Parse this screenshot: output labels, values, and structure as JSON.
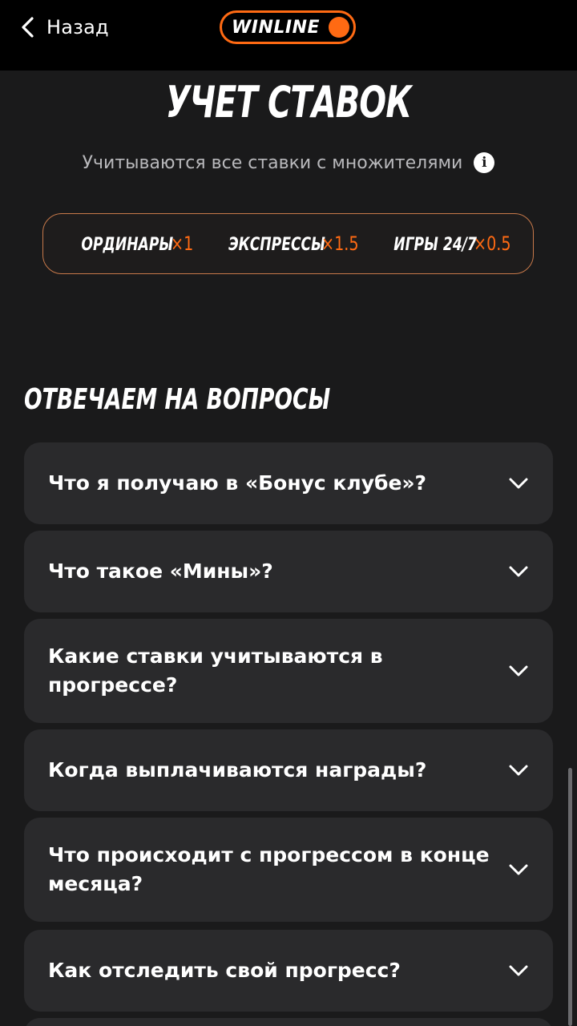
{
  "header": {
    "back_label": "Назад",
    "logo_text": "WINLINE",
    "brand_color": "#ff6a13"
  },
  "bets": {
    "title": "УЧЕТ СТАВОК",
    "subtitle": "Учитываются все ставки с множителями",
    "info_icon": "info-icon",
    "multipliers": [
      {
        "label": "ОРДИНАРЫ",
        "value": "×1"
      },
      {
        "label": "ЭКСПРЕССЫ",
        "value": "×1.5"
      },
      {
        "label": "ИГРЫ 24/7",
        "value": "×0.5"
      }
    ]
  },
  "faq": {
    "title": "ОТВЕЧАЕМ НА ВОПРОСЫ",
    "items": [
      {
        "question": "Что я получаю в «Бонус клубе»?",
        "icon": "chevron-down-icon"
      },
      {
        "question": "Что такое «Мины»?",
        "icon": "chevron-down-icon"
      },
      {
        "question": "Какие ставки учитываются в прогрессе?",
        "icon": "chevron-down-icon"
      },
      {
        "question": "Когда выплачиваются награды?",
        "icon": "chevron-down-icon"
      },
      {
        "question": "Что происходит с прогрессом в конце месяца?",
        "icon": "chevron-down-icon"
      },
      {
        "question": "Как отследить свой прогресс?",
        "icon": "chevron-down-icon"
      }
    ]
  }
}
